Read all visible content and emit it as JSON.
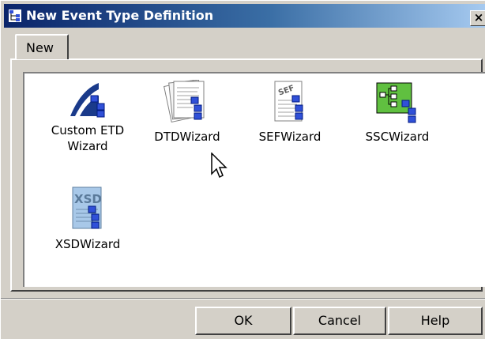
{
  "window": {
    "title": "New Event Type Definition",
    "close_label": "×"
  },
  "tabs": [
    {
      "label": "New"
    }
  ],
  "items": [
    {
      "label_line1": "Custom ETD",
      "label_line2": "Wizard",
      "icon": "custom-etd-wizard-icon"
    },
    {
      "label_line1": "DTDWizard",
      "label_line2": "",
      "icon": "dtd-wizard-icon"
    },
    {
      "label_line1": "SEFWizard",
      "label_line2": "",
      "icon": "sef-wizard-icon"
    },
    {
      "label_line1": "SSCWizard",
      "label_line2": "",
      "icon": "ssc-wizard-icon"
    },
    {
      "label_line1": "XSDWizard",
      "label_line2": "",
      "icon": "xsd-wizard-icon"
    }
  ],
  "buttons": {
    "ok": "OK",
    "cancel": "Cancel",
    "help": "Help"
  },
  "icon_text": {
    "sef": "SEF",
    "xsd": "XSD"
  },
  "colors": {
    "titlebar_start": "#0a246a",
    "titlebar_end": "#a6caf0",
    "dialog_bg": "#d4d0c8",
    "node_blue": "#3050d8",
    "ssc_green": "#60c040"
  }
}
